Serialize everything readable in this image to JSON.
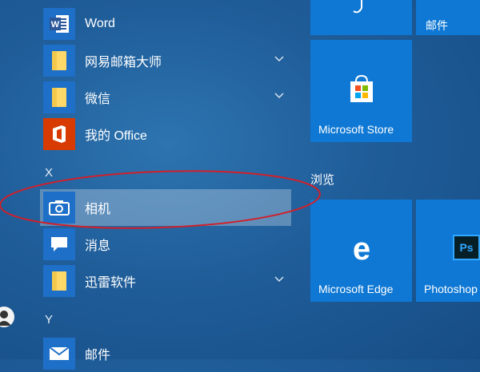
{
  "app_list": {
    "items": [
      {
        "label": "Word",
        "icon": "word-icon"
      },
      {
        "label": "网易邮箱大师",
        "icon": "folder-icon"
      },
      {
        "label": "微信",
        "icon": "folder-icon"
      },
      {
        "label": "我的 Office",
        "icon": "office-icon"
      },
      {
        "label": "相机",
        "icon": "camera-icon"
      },
      {
        "label": "消息",
        "icon": "messaging-icon"
      },
      {
        "label": "迅雷软件",
        "icon": "folder-icon"
      },
      {
        "label": "邮件",
        "icon": "mail-icon"
      }
    ],
    "letters": [
      "X",
      "Y"
    ]
  },
  "tiles": {
    "mail_label": "邮件",
    "store_label": "Microsoft Store",
    "browse_group": "浏览",
    "edge_label": "Microsoft Edge",
    "photoshop_label": "Photoshop",
    "photoshop_badge": "Ps"
  },
  "colors": {
    "tile_blue": "#0f78d4",
    "word_blue": "#2b579a",
    "office_red": "#d83b01",
    "folder_yellow": "#ffd86a",
    "annotation_red": "#d0202a"
  }
}
